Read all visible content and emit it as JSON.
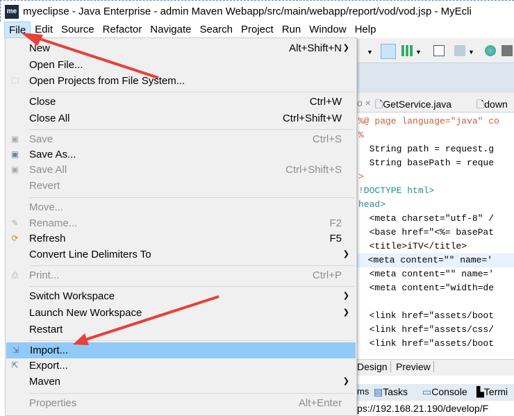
{
  "window": {
    "title": "myeclipse - Java Enterprise - admin Maven Webapp/src/main/webapp/report/vod/vod.jsp - MyEcli",
    "logo": "me"
  },
  "menubar": [
    "File",
    "Edit",
    "Source",
    "Refactor",
    "Navigate",
    "Search",
    "Project",
    "Run",
    "Window",
    "Help"
  ],
  "file_menu": [
    {
      "label": "New",
      "shortcut": "Alt+Shift+N",
      "submenu": true,
      "disabled": false
    },
    {
      "label": "Open File...",
      "shortcut": "",
      "disabled": false
    },
    {
      "label": "Open Projects from File System...",
      "shortcut": "",
      "icon": "folder-icon",
      "disabled": false
    },
    {
      "label": "Close",
      "shortcut": "Ctrl+W",
      "disabled": false
    },
    {
      "label": "Close All",
      "shortcut": "Ctrl+Shift+W",
      "disabled": false
    },
    {
      "label": "Save",
      "shortcut": "Ctrl+S",
      "icon": "save-icon",
      "disabled": true
    },
    {
      "label": "Save As...",
      "shortcut": "",
      "icon": "save-as-icon",
      "disabled": false
    },
    {
      "label": "Save All",
      "shortcut": "Ctrl+Shift+S",
      "icon": "save-all-icon",
      "disabled": true
    },
    {
      "label": "Revert",
      "shortcut": "",
      "disabled": true
    },
    {
      "label": "Move...",
      "shortcut": "",
      "disabled": true
    },
    {
      "label": "Rename...",
      "shortcut": "F2",
      "icon": "rename-icon",
      "disabled": true
    },
    {
      "label": "Refresh",
      "shortcut": "F5",
      "icon": "refresh-icon",
      "disabled": false
    },
    {
      "label": "Convert Line Delimiters To",
      "shortcut": "",
      "submenu": true,
      "disabled": false
    },
    {
      "label": "Print...",
      "shortcut": "Ctrl+P",
      "icon": "print-icon",
      "disabled": true
    },
    {
      "label": "Switch Workspace",
      "shortcut": "",
      "submenu": true,
      "disabled": false
    },
    {
      "label": "Launch New Workspace",
      "shortcut": "",
      "submenu": true,
      "disabled": false
    },
    {
      "label": "Restart",
      "shortcut": "",
      "disabled": false
    },
    {
      "label": "Import...",
      "shortcut": "",
      "icon": "import-icon",
      "disabled": false,
      "selected": true
    },
    {
      "label": "Export...",
      "shortcut": "",
      "icon": "export-icon",
      "disabled": false
    },
    {
      "label": "Maven",
      "shortcut": "",
      "submenu": true,
      "disabled": false
    },
    {
      "label": "Properties",
      "shortcut": "Alt+Enter",
      "disabled": true
    }
  ],
  "editor_tabs": [
    "GetService.java",
    "down"
  ],
  "code_lines": [
    "%@ page language=\"java\" co",
    "%",
    "  String path = request.g",
    "  String basePath = reque",
    ">",
    "!DOCTYPE html>",
    "head>",
    "  <meta charset=\"utf-8\" /",
    "  <base href=\"<%= basePat",
    "  <title>iTV</title>",
    "  <meta content=\"\" name='",
    "  <meta content=\"\" name='",
    "  <meta content=\"width=de",
    "",
    "  <link href=\"assets/boot",
    "  <link href=\"assets/css/",
    "  <link href=\"assets/boot"
  ],
  "editor_bottom_tabs": [
    "Design",
    "Preview"
  ],
  "views": [
    "ms",
    "Tasks",
    "Console",
    "Termi"
  ],
  "url_bar": "ps://192.168.21.190/develop/F",
  "colors": {
    "menu_bg": "#f0f0f0",
    "selected": "#91c9f7",
    "arrow": "#e8403a"
  }
}
